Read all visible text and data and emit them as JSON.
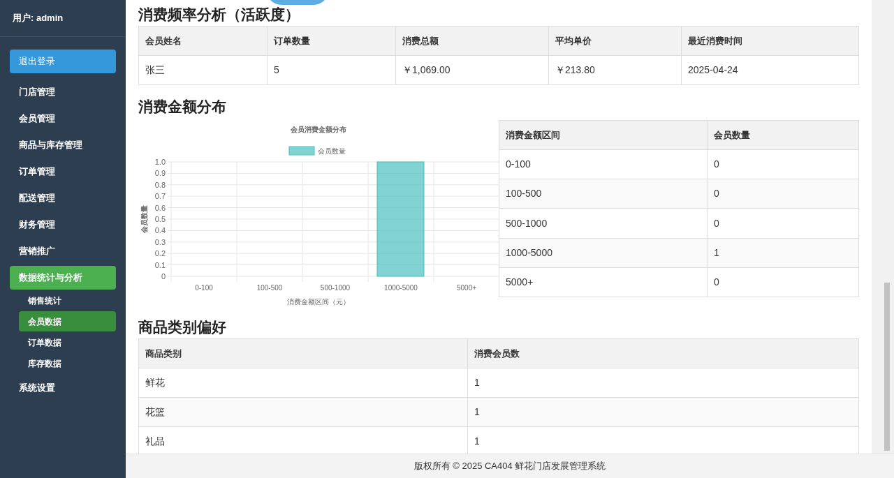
{
  "sidebar": {
    "user": "用户: admin",
    "logout": "退出登录",
    "items": [
      {
        "label": "门店管理",
        "selected": false
      },
      {
        "label": "会员管理",
        "selected": false
      },
      {
        "label": "商品与库存管理",
        "selected": false
      },
      {
        "label": "订单管理",
        "selected": false
      },
      {
        "label": "配送管理",
        "selected": false
      },
      {
        "label": "财务管理",
        "selected": false
      },
      {
        "label": "营销推广",
        "selected": false
      },
      {
        "label": "数据统计与分析",
        "selected": true,
        "expanded": true,
        "children": [
          {
            "label": "销售统计",
            "selected": false
          },
          {
            "label": "会员数据",
            "selected": true
          },
          {
            "label": "订单数据",
            "selected": false
          },
          {
            "label": "库存数据",
            "selected": false
          }
        ]
      },
      {
        "label": "系统设置",
        "selected": false
      }
    ]
  },
  "frequency": {
    "title": "消费频率分析（活跃度）",
    "columns": [
      "会员姓名",
      "订单数量",
      "消费总额",
      "平均单价",
      "最近消费时间"
    ],
    "rows": [
      [
        "张三",
        "5",
        "￥1,069.00",
        "￥213.80",
        "2025-04-24"
      ]
    ]
  },
  "distribution": {
    "title": "消费金额分布",
    "chart_data": {
      "type": "bar",
      "grid": true,
      "title": "会员消费金额分布",
      "xlabel": "消费金额区间（元）",
      "ylabel": "会员数量",
      "categories": [
        "0-100",
        "100-500",
        "500-1000",
        "1000-5000",
        "5000+"
      ],
      "series": [
        {
          "name": "会员数量",
          "color": "#4bc0c0",
          "values": [
            0,
            0,
            0,
            1,
            0
          ]
        }
      ],
      "ylim": [
        0,
        1
      ],
      "yticks": [
        {
          "value": 0,
          "label": "0"
        },
        0.1,
        0.2,
        0.3,
        0.4,
        0.5,
        0.6,
        0.7,
        0.8,
        0.9,
        {
          "value": 1,
          "label": "1.0"
        }
      ]
    },
    "columns": [
      "消费金额区间",
      "会员数量"
    ],
    "rows": [
      [
        "0-100",
        "0"
      ],
      [
        "100-500",
        "0"
      ],
      [
        "500-1000",
        "0"
      ],
      [
        "1000-5000",
        "1"
      ],
      [
        "5000+",
        "0"
      ]
    ]
  },
  "category": {
    "title": "商品类别偏好",
    "columns": [
      "商品类别",
      "消费会员数"
    ],
    "rows": [
      [
        "鲜花",
        "1"
      ],
      [
        "花篮",
        "1"
      ],
      [
        "礼品",
        "1"
      ]
    ]
  },
  "footer": "版权所有 © 2025 CA404 鲜花门店发展管理系统"
}
